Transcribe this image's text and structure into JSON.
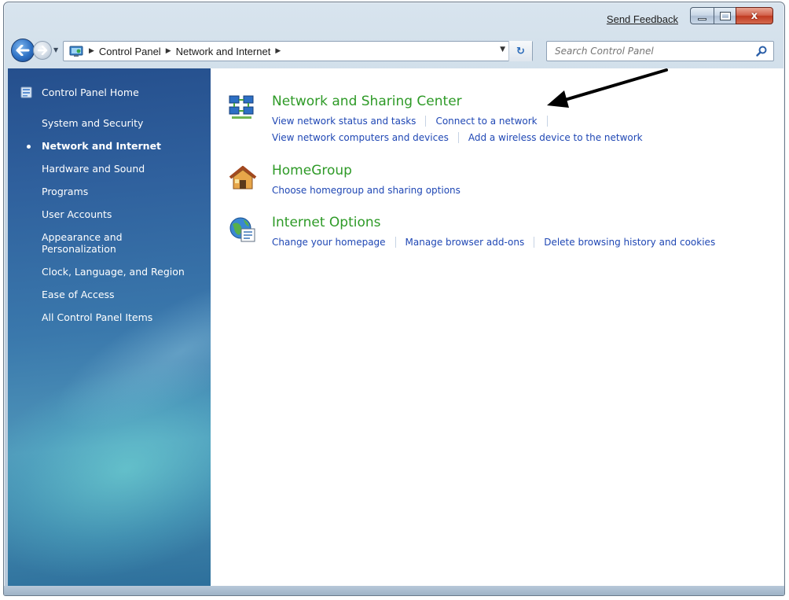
{
  "window": {
    "send_feedback_label": "Send Feedback",
    "close_glyph": "x"
  },
  "navbar": {
    "breadcrumbs": [
      "Control Panel",
      "Network and Internet"
    ],
    "search_placeholder": "Search Control Panel",
    "refresh_glyph": "↻"
  },
  "sidebar": {
    "home": "Control Panel Home",
    "items": [
      {
        "label": "System and Security"
      },
      {
        "label": "Network and Internet",
        "current": true
      },
      {
        "label": "Hardware and Sound"
      },
      {
        "label": "Programs"
      },
      {
        "label": "User Accounts"
      },
      {
        "label": "Appearance and Personalization"
      },
      {
        "label": "Clock, Language, and Region"
      },
      {
        "label": "Ease of Access"
      },
      {
        "label": "All Control Panel Items"
      }
    ]
  },
  "categories": [
    {
      "title": "Network and Sharing Center",
      "icon": "network-icon",
      "link_rows": [
        [
          "View network status and tasks",
          "Connect to a network"
        ],
        [
          "View network computers and devices",
          "Add a wireless device to the network"
        ]
      ]
    },
    {
      "title": "HomeGroup",
      "icon": "homegroup-icon",
      "link_rows": [
        [
          "Choose homegroup and sharing options"
        ]
      ]
    },
    {
      "title": "Internet Options",
      "icon": "internet-options-icon",
      "link_rows": [
        [
          "Change your homepage",
          "Manage browser add-ons",
          "Delete browsing history and cookies"
        ]
      ]
    }
  ],
  "colors": {
    "category_title": "#2e9a27",
    "link": "#1f47b4",
    "sidebar_bg": "#2f609d",
    "sidebar_text": "#ffffff"
  }
}
